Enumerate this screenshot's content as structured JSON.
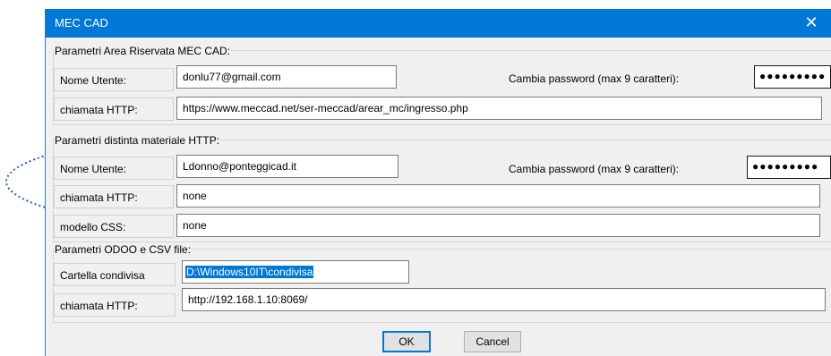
{
  "window": {
    "title": "MEC CAD",
    "close_symbol": "✕"
  },
  "group_mec": {
    "title": "Parametri  Area Riservata MEC CAD:",
    "user_label": "Nome Utente:",
    "user_value": "donlu77@gmail.com",
    "password_label": "Cambia password  (max 9 caratteri):",
    "password_mask": "●●●●●●●●●",
    "http_label": "chiamata HTTP:",
    "http_value": "https://www.meccad.net/ser-meccad/arear_mc/ingresso.php"
  },
  "group_bom": {
    "title": "Parametri distinta materiale HTTP:",
    "user_label": "Nome Utente:",
    "user_value": "Ldonno@ponteggicad.it",
    "password_label": "Cambia password (max 9 caratteri):",
    "password_mask": "●●●●●●●●●",
    "http_label": "chiamata HTTP:",
    "http_value": "none",
    "css_label": "modello CSS:",
    "css_value": "none"
  },
  "group_odoo": {
    "title": "Parametri ODOO e CSV file:",
    "folder_label": "Cartella condivisa",
    "folder_value": "D:\\Windows10IT\\condivisa",
    "http_label": "chiamata HTTP:",
    "http_value": "http://192.168.1.10:8069/"
  },
  "buttons": {
    "ok": "OK",
    "cancel": "Cancel"
  },
  "colors": {
    "titlebar": "#0078d7",
    "selection": "#0078d7",
    "annotation": "#1f5fbf"
  }
}
